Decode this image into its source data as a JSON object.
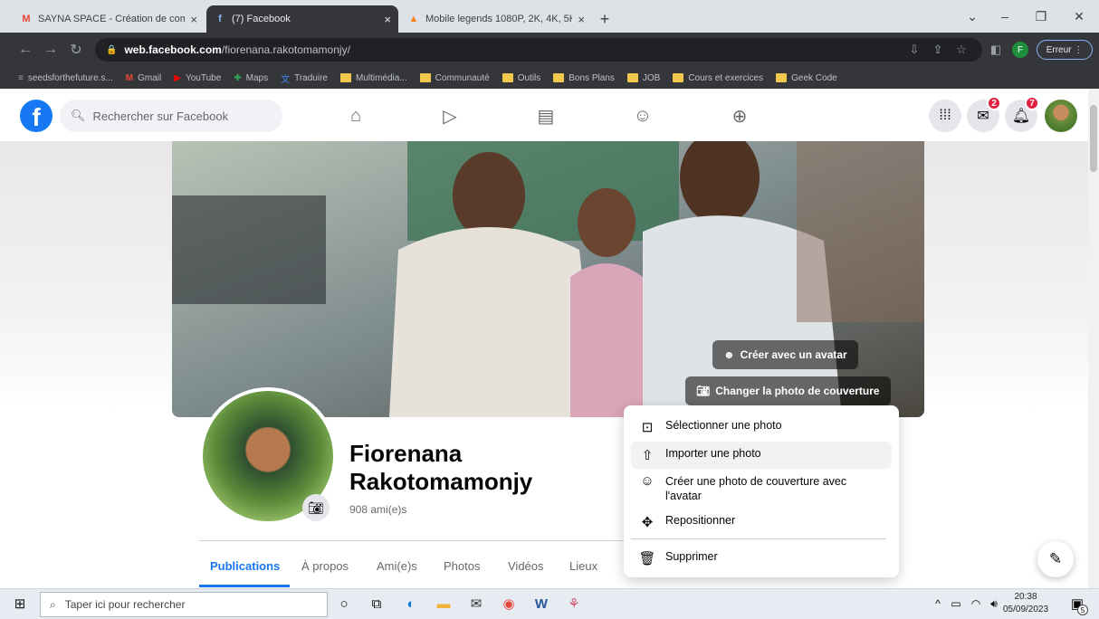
{
  "browser": {
    "tabs": [
      {
        "title": "SAYNA SPACE - Création de com",
        "favicon": "gmail-icon",
        "active": false
      },
      {
        "title": "(7) Facebook",
        "favicon": "facebook-icon",
        "active": true
      },
      {
        "title": "Mobile legends 1080P, 2K, 4K, 5K",
        "favicon": "fire-icon",
        "active": false
      }
    ],
    "new_tab": "+",
    "url_host": "web.facebook.com",
    "url_path": "/fiorenana.rakotomamonjy/",
    "profile_letter": "F",
    "error_label": "Erreur",
    "bookmarks": [
      "seedsforthefuture.s...",
      "Gmail",
      "YouTube",
      "Maps",
      "Traduire",
      "Multimédia...",
      "Communauté",
      "Outils",
      "Bons Plans",
      "JOB",
      "Cours et exercices",
      "Geek Code"
    ]
  },
  "facebook": {
    "logo": "f",
    "search_placeholder": "Rechercher sur Facebook",
    "messenger_badge": "2",
    "notifications_badge": "7",
    "profile": {
      "name": "Fiorenana Rakotomamonjy",
      "friends": "908 ami(e)s"
    },
    "cover_buttons": {
      "avatar": "Créer avec un avatar",
      "change_cover": "Changer la photo de couverture"
    },
    "tabs": [
      "Publications",
      "À propos",
      "Ami(e)s",
      "Photos",
      "Vidéos",
      "Lieux"
    ],
    "menu": {
      "select_photo": "Sélectionner une photo",
      "import_photo": "Importer une photo",
      "avatar_cover": "Créer une photo de couverture avec l'avatar",
      "reposition": "Repositionner",
      "delete": "Supprimer"
    }
  },
  "taskbar": {
    "search_placeholder": "Taper ici pour rechercher",
    "time": "20:38",
    "date": "05/09/2023",
    "notif_count": "5"
  },
  "colors": {
    "fb_blue": "#1877f2",
    "badge_red": "#e41e3f",
    "chrome_dark": "#35363a"
  }
}
